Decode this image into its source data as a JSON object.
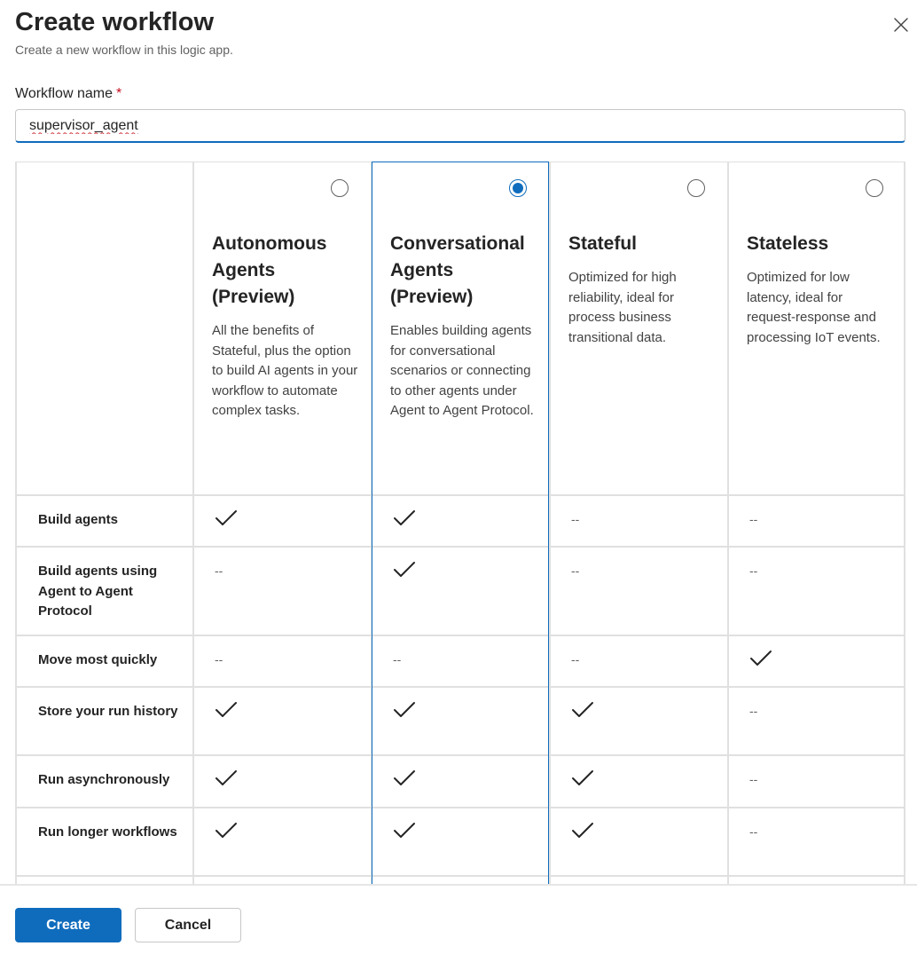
{
  "dialog": {
    "title": "Create workflow",
    "subtitle": "Create a new workflow in this logic app.",
    "close_icon": "close-icon"
  },
  "form": {
    "name_label": "Workflow name",
    "required_mark": "*",
    "name_value": "supervisor_agent"
  },
  "columns": [
    {
      "title": "Autonomous Agents (Preview)",
      "description": "All the benefits of Stateful, plus the option to build AI agents in your workflow to automate complex tasks.",
      "selected": false
    },
    {
      "title": "Conversational Agents (Preview)",
      "description": "Enables building agents for conversational scenarios or connecting to other agents under Agent to Agent Protocol.",
      "selected": true
    },
    {
      "title": "Stateful",
      "description": "Optimized for high reliability, ideal for process business transitional data.",
      "selected": false
    },
    {
      "title": "Stateless",
      "description": "Optimized for low latency, ideal for request-response and processing IoT events.",
      "selected": false
    }
  ],
  "features": [
    {
      "label": "Build agents",
      "values": [
        true,
        true,
        false,
        false
      ]
    },
    {
      "label": "Build agents using Agent to Agent Protocol",
      "values": [
        false,
        true,
        false,
        false
      ]
    },
    {
      "label": "Move most quickly",
      "values": [
        false,
        false,
        false,
        true
      ]
    },
    {
      "label": "Store your run history",
      "values": [
        true,
        true,
        true,
        false
      ]
    },
    {
      "label": "Run asynchronously",
      "values": [
        true,
        true,
        true,
        false
      ]
    },
    {
      "label": "Run longer workflows",
      "values": [
        true,
        true,
        true,
        false
      ]
    }
  ],
  "empty_mark": "--",
  "icons": {
    "check": "checkmark-icon"
  },
  "colors": {
    "accent": "#0f6cbd",
    "border": "#e0e0e0",
    "required": "#c50f1f"
  },
  "footer": {
    "create_label": "Create",
    "cancel_label": "Cancel"
  }
}
